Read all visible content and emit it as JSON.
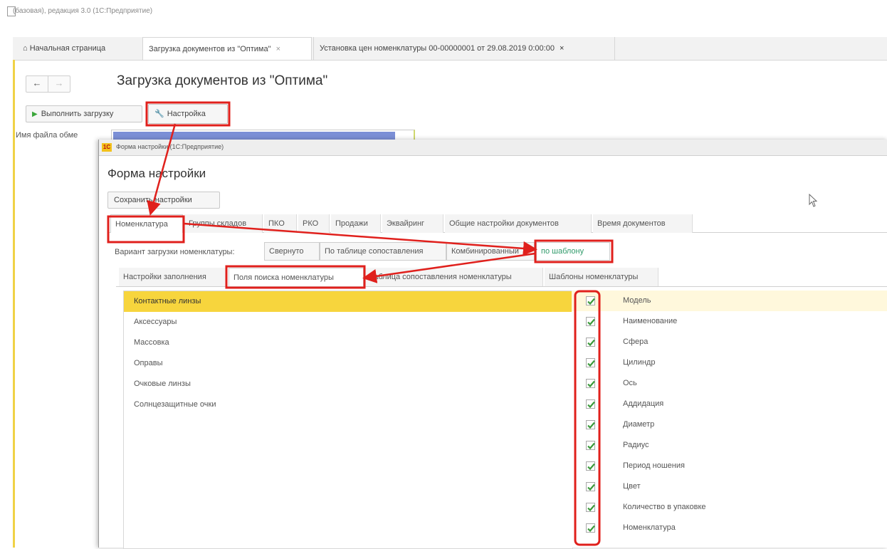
{
  "window": {
    "title": "(базовая), редакция 3.0  (1С:Предприятие)"
  },
  "tabs": [
    {
      "label": "Начальная страница"
    },
    {
      "label": "Загрузка документов из \"Оптима\"",
      "close": "×"
    },
    {
      "label": "Установка цен номенклатуры 00-00000001 от 29.08.2019 0:00:00",
      "close": "×"
    }
  ],
  "page": {
    "title": "Загрузка документов из \"Оптима\"",
    "run_button": "Выполнить загрузку",
    "settings_button": "Настройка",
    "file_label": "Имя файла обме"
  },
  "dialog": {
    "window_title": "Форма настройки  (1С:Предприятие)",
    "heading": "Форма настройки",
    "save_button": "Сохранить настройки",
    "main_tabs": [
      "Номенклатура",
      "Группы складов",
      "ПКО",
      "РКО",
      "Продажи",
      "Эквайринг",
      "Общие настройки документов",
      "Время документов"
    ],
    "variant_label": "Вариант загрузки номенклатуры:",
    "variants": [
      "Свернуто",
      "По таблице сопоставления",
      "Комбинированный",
      "по шаблону"
    ],
    "sub_tabs": [
      "Настройки заполнения",
      "Поля поиска номенклатуры",
      "Таблица сопоставления номенклатуры",
      "Шаблоны номенклатуры"
    ],
    "categories": [
      "Контактные линзы",
      "Аксессуары",
      "Массовка",
      "Оправы",
      "Очковые линзы",
      "Солнцезащитные очки"
    ],
    "fields": [
      {
        "label": "Модель",
        "checked": true
      },
      {
        "label": "Наименование",
        "checked": true
      },
      {
        "label": "Сфера",
        "checked": true
      },
      {
        "label": "Цилиндр",
        "checked": true
      },
      {
        "label": "Ось",
        "checked": true
      },
      {
        "label": "Аддидация",
        "checked": true
      },
      {
        "label": "Диаметр",
        "checked": true
      },
      {
        "label": "Радиус",
        "checked": true
      },
      {
        "label": "Период ношения",
        "checked": true
      },
      {
        "label": "Цвет",
        "checked": true
      },
      {
        "label": "Количество в упаковке",
        "checked": true
      },
      {
        "label": "Номенклатура",
        "checked": true
      }
    ]
  },
  "colors": {
    "highlight_red": "#e0201c",
    "selected_row": "#f7d53d",
    "check_green": "#3a9a3a",
    "accent_strip": "#f0d246"
  }
}
